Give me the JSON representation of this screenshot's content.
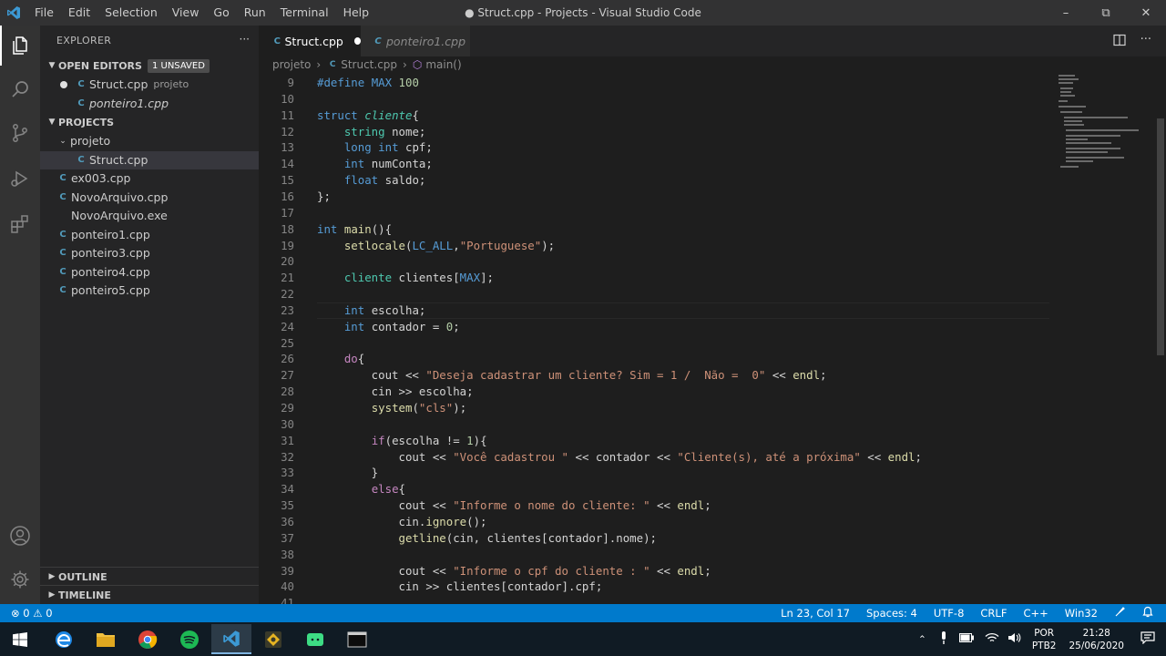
{
  "window": {
    "title": "● Struct.cpp - Projects - Visual Studio Code",
    "menu": [
      "File",
      "Edit",
      "Selection",
      "View",
      "Go",
      "Run",
      "Terminal",
      "Help"
    ]
  },
  "sidebar": {
    "title": "EXPLORER",
    "open_editors": {
      "label": "OPEN EDITORS",
      "badge": "1 UNSAVED",
      "items": [
        {
          "name": "Struct.cpp",
          "desc": "projeto"
        },
        {
          "name": "ponteiro1.cpp",
          "desc": ""
        }
      ]
    },
    "projects": {
      "label": "PROJECTS",
      "folder": "projeto",
      "folder_items": [
        "Struct.cpp"
      ],
      "items": [
        "ex003.cpp",
        "NovoArquivo.cpp",
        "NovoArquivo.exe",
        "ponteiro1.cpp",
        "ponteiro3.cpp",
        "ponteiro4.cpp",
        "ponteiro5.cpp"
      ]
    },
    "outline": "OUTLINE",
    "timeline": "TIMELINE"
  },
  "tabs": [
    {
      "label": "Struct.cpp",
      "active": true,
      "dirty": true
    },
    {
      "label": "ponteiro1.cpp",
      "active": false
    }
  ],
  "breadcrumb": [
    "projeto",
    "Struct.cpp",
    "main()"
  ],
  "editor": {
    "lines": [
      {
        "n": "9",
        "html": "<span class=\"mac\">#define</span> <span class=\"mac\">MAX</span> <span class=\"num\">100</span>"
      },
      {
        "n": "10",
        "html": ""
      },
      {
        "n": "11",
        "html": "<span class=\"kw\">struct</span> <span class=\"ty\"><i>cliente</i></span>{"
      },
      {
        "n": "12",
        "html": "    <span class=\"ty\">string</span> nome;"
      },
      {
        "n": "13",
        "html": "    <span class=\"kw\">long</span> <span class=\"kw\">int</span> cpf;"
      },
      {
        "n": "14",
        "html": "    <span class=\"kw\">int</span> numConta;"
      },
      {
        "n": "15",
        "html": "    <span class=\"kw\">float</span> saldo;"
      },
      {
        "n": "16",
        "html": "};"
      },
      {
        "n": "17",
        "html": ""
      },
      {
        "n": "18",
        "html": "<span class=\"kw\">int</span> <span class=\"fn\">main</span>(){"
      },
      {
        "n": "19",
        "html": "    <span class=\"fn\">setlocale</span>(<span class=\"mac\">LC_ALL</span>,<span class=\"str\">\"Portuguese\"</span>);"
      },
      {
        "n": "20",
        "html": ""
      },
      {
        "n": "21",
        "html": "    <span class=\"ty\">cliente</span> clientes[<span class=\"mac\">MAX</span>];"
      },
      {
        "n": "22",
        "html": ""
      },
      {
        "n": "23",
        "html": "    <span class=\"kw\">int</span> escolha;"
      },
      {
        "n": "24",
        "html": "    <span class=\"kw\">int</span> contador = <span class=\"num\">0</span>;"
      },
      {
        "n": "25",
        "html": ""
      },
      {
        "n": "26",
        "html": "    <span class=\"ctl\">do</span>{"
      },
      {
        "n": "27",
        "html": "        cout &lt;&lt; <span class=\"str\">\"Deseja cadastrar um cliente? Sim = 1 /  Não =  0\"</span> &lt;&lt; <span class=\"fn\">endl</span>;"
      },
      {
        "n": "28",
        "html": "        cin &gt;&gt; escolha;"
      },
      {
        "n": "29",
        "html": "        <span class=\"fn\">system</span>(<span class=\"str\">\"cls\"</span>);"
      },
      {
        "n": "30",
        "html": ""
      },
      {
        "n": "31",
        "html": "        <span class=\"ctl\">if</span>(escolha != <span class=\"num\">1</span>){"
      },
      {
        "n": "32",
        "html": "            cout &lt;&lt; <span class=\"str\">\"Você cadastrou \"</span> &lt;&lt; contador &lt;&lt; <span class=\"str\">\"Cliente(s), até a próxima\"</span> &lt;&lt; <span class=\"fn\">endl</span>;"
      },
      {
        "n": "33",
        "html": "        }"
      },
      {
        "n": "34",
        "html": "        <span class=\"ctl\">else</span>{"
      },
      {
        "n": "35",
        "html": "            cout &lt;&lt; <span class=\"str\">\"Informe o nome do cliente: \"</span> &lt;&lt; <span class=\"fn\">endl</span>;"
      },
      {
        "n": "36",
        "html": "            cin.<span class=\"fn\">ignore</span>();"
      },
      {
        "n": "37",
        "html": "            <span class=\"fn\">getline</span>(cin, clientes[contador].nome);"
      },
      {
        "n": "38",
        "html": ""
      },
      {
        "n": "39",
        "html": "            cout &lt;&lt; <span class=\"str\">\"Informe o cpf do cliente : \"</span> &lt;&lt; <span class=\"fn\">endl</span>;"
      },
      {
        "n": "40",
        "html": "            cin &gt;&gt; clientes[contador].cpf;"
      },
      {
        "n": "41",
        "html": ""
      }
    ]
  },
  "status": {
    "problems": "⊗ 0 ⚠ 0",
    "position": "Ln 23, Col 17",
    "spaces": "Spaces: 4",
    "encoding": "UTF-8",
    "eol": "CRLF",
    "language": "C++",
    "platform": "Win32"
  },
  "taskbar": {
    "lang_top": "POR",
    "lang_bottom": "PTB2",
    "time": "21:28",
    "date": "25/06/2020"
  },
  "colors": {
    "accent": "#007acc",
    "sidebar": "#252526",
    "editor": "#1e1e1e"
  }
}
